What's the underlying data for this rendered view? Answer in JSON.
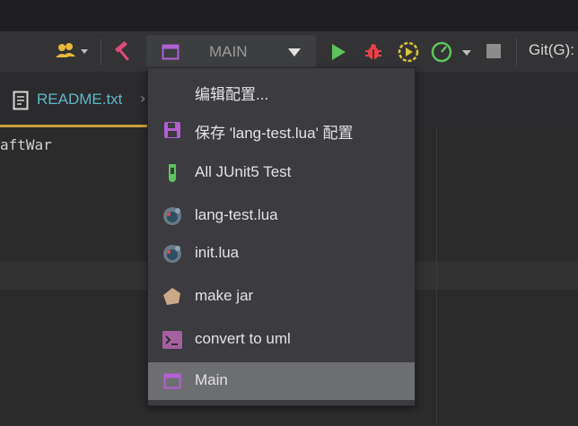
{
  "toolbar": {
    "run_config_label": "MAIN",
    "git_label": "Git(G):",
    "icons": [
      "users-icon",
      "hammer-icon",
      "run-icon",
      "debug-icon",
      "run-with-coverage-icon",
      "profiler-icon",
      "stop-icon"
    ]
  },
  "tab": {
    "filename": "README.txt",
    "close": "›"
  },
  "editor": {
    "visible_text": "aftWar"
  },
  "menu": {
    "items": [
      {
        "label": "编辑配置...",
        "icon": ""
      },
      {
        "label": "保存 'lang-test.lua' 配置",
        "icon": "save-icon"
      },
      {
        "label": "All JUnit5 Test",
        "icon": "test-tube-icon"
      },
      {
        "label": "lang-test.lua",
        "icon": "lua-icon"
      },
      {
        "label": "init.lua",
        "icon": "lua-icon"
      },
      {
        "label": "make jar",
        "icon": "polygon-icon"
      },
      {
        "label": "convert to uml",
        "icon": "terminal-icon"
      },
      {
        "label": "Main",
        "icon": "window-icon"
      }
    ],
    "selected_index": 7
  },
  "colors": {
    "accent_purple": "#b25fd4",
    "run_green": "#5ec45b",
    "debug_red": "#e8414a",
    "tab_cyan": "#5fb7c9",
    "tab_underline": "#c9a13a"
  }
}
